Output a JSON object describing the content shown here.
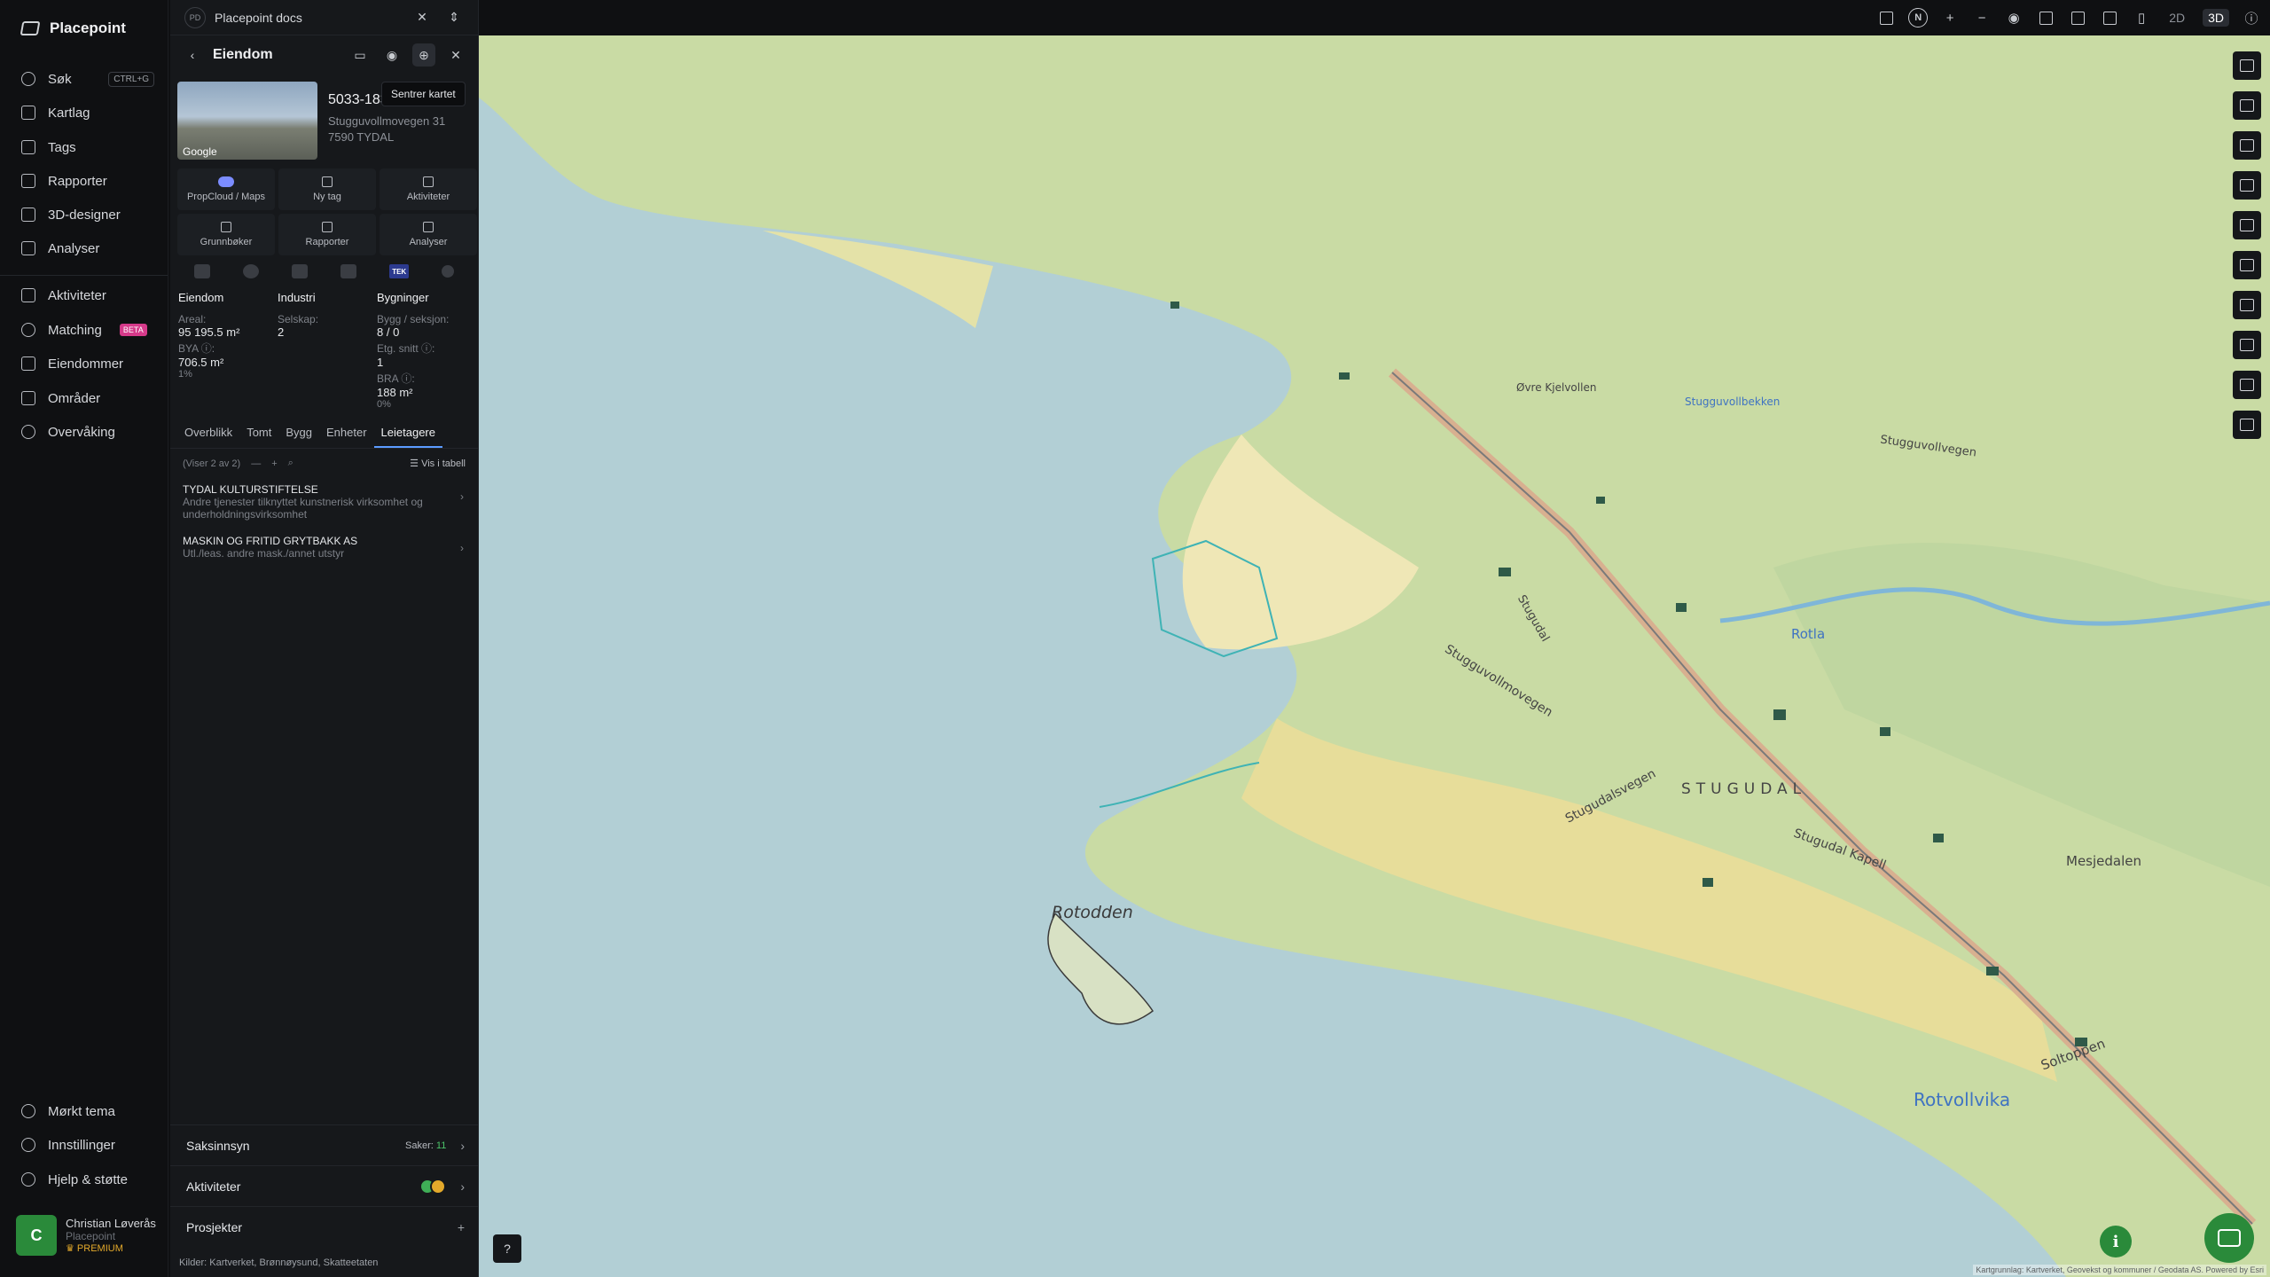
{
  "app": {
    "name": "Placepoint"
  },
  "nav": {
    "items": [
      {
        "label": "Søk",
        "shortcut": "CTRL+G"
      },
      {
        "label": "Kartlag"
      },
      {
        "label": "Tags"
      },
      {
        "label": "Rapporter"
      },
      {
        "label": "3D-designer"
      },
      {
        "label": "Analyser"
      },
      {
        "label": "Aktiviteter"
      },
      {
        "label": "Matching",
        "badge": "BETA"
      },
      {
        "label": "Eiendommer"
      },
      {
        "label": "Områder"
      },
      {
        "label": "Overvåking"
      }
    ],
    "bottom": [
      {
        "label": "Mørkt tema"
      },
      {
        "label": "Innstillinger"
      },
      {
        "label": "Hjelp & støtte"
      }
    ],
    "user": {
      "initial": "C",
      "name": "Christian Løverås",
      "org": "Placepoint",
      "tier": "PREMIUM"
    }
  },
  "docs": {
    "badge": "PD",
    "title": "Placepoint docs"
  },
  "panel": {
    "title": "Eiendom",
    "tooltip": "Sentrer kartet",
    "photo_label": "Google",
    "property": {
      "id": "5033-183/123/0/0",
      "address": "Stugguvollmovegen 31",
      "postal": "7590 TYDAL"
    },
    "actions": [
      {
        "label": "PropCloud / Maps",
        "icon": "cloud-icon"
      },
      {
        "label": "Ny tag",
        "icon": "bookmark-icon"
      },
      {
        "label": "Aktiviteter",
        "icon": "chat-icon"
      },
      {
        "label": "Grunnbøker",
        "icon": "download-icon"
      },
      {
        "label": "Rapporter",
        "icon": "chart-icon"
      },
      {
        "label": "Analyser",
        "icon": "bolt-icon"
      }
    ],
    "tek_label": "TEK",
    "stats": {
      "eiendom": {
        "heading": "Eiendom",
        "area_label": "Areal:",
        "area_value": "95 195.5",
        "area_unit": "m²",
        "bya_label": "BYA ⓘ:",
        "bya_value": "706.5",
        "bya_unit": "m²",
        "bya_pct": "1%"
      },
      "industri": {
        "heading": "Industri",
        "company_label": "Selskap:",
        "company_value": "2"
      },
      "bygninger": {
        "heading": "Bygninger",
        "bygg_label": "Bygg / seksjon:",
        "bygg_value": "8 / 0",
        "etg_label": "Etg. snitt ⓘ:",
        "etg_value": "1",
        "bra_label": "BRA ⓘ:",
        "bra_value": "188",
        "bra_unit": "m²",
        "bra_pct": "0%"
      }
    },
    "tabs": [
      "Overblikk",
      "Tomt",
      "Bygg",
      "Enheter",
      "Leietagere"
    ],
    "active_tab": "Leietagere",
    "list": {
      "count_text": "(Viser 2 av 2)",
      "table_label": "Vis i tabell",
      "items": [
        {
          "name": "TYDAL KULTURSTIFTELSE",
          "desc": "Andre tjenester tilknyttet kunstnerisk virksomhet og underholdningsvirksomhet"
        },
        {
          "name": "MASKIN OG FRITID GRYTBAKK AS",
          "desc": "Utl./leas. andre mask./annet utstyr"
        }
      ]
    },
    "sections": {
      "saksinnsyn": {
        "label": "Saksinnsyn",
        "count_label": "Saker:",
        "count": "11"
      },
      "aktiviteter": {
        "label": "Aktiviteter"
      },
      "prosjekter": {
        "label": "Prosjekter",
        "action": "+"
      }
    },
    "sources": {
      "prefix": "Kilder:",
      "items": [
        "Kartverket,",
        "Brønnøysund,",
        "Skatteetaten"
      ]
    }
  },
  "topbar": {
    "compass": "N",
    "mode_2d": "2D",
    "mode_3d": "3D",
    "active_mode": "3D"
  },
  "map": {
    "labels": [
      "Rotodden",
      "Rotvollvika",
      "STUGUDAL",
      "Stugguvollmovegen",
      "Stugudalsvegen",
      "Mesjedalen",
      "Stugudal Kapell",
      "Rotla",
      "Stugudal",
      "Soltoppen",
      "Stugguvollbekken",
      "Stugguvollvegen",
      "Øvre Kjelvollen"
    ],
    "attribution": "Kartgrunnlag: Kartverket, Geovekst og kommuner / Geodata AS. Powered by Esri"
  },
  "colors": {
    "accent": "#2a8a3a",
    "water": "#b2cfd5",
    "land": "#c8d9a3",
    "tab_active": "#5b9bff",
    "beta": "#d63a8a",
    "premium": "#e3a92b"
  }
}
